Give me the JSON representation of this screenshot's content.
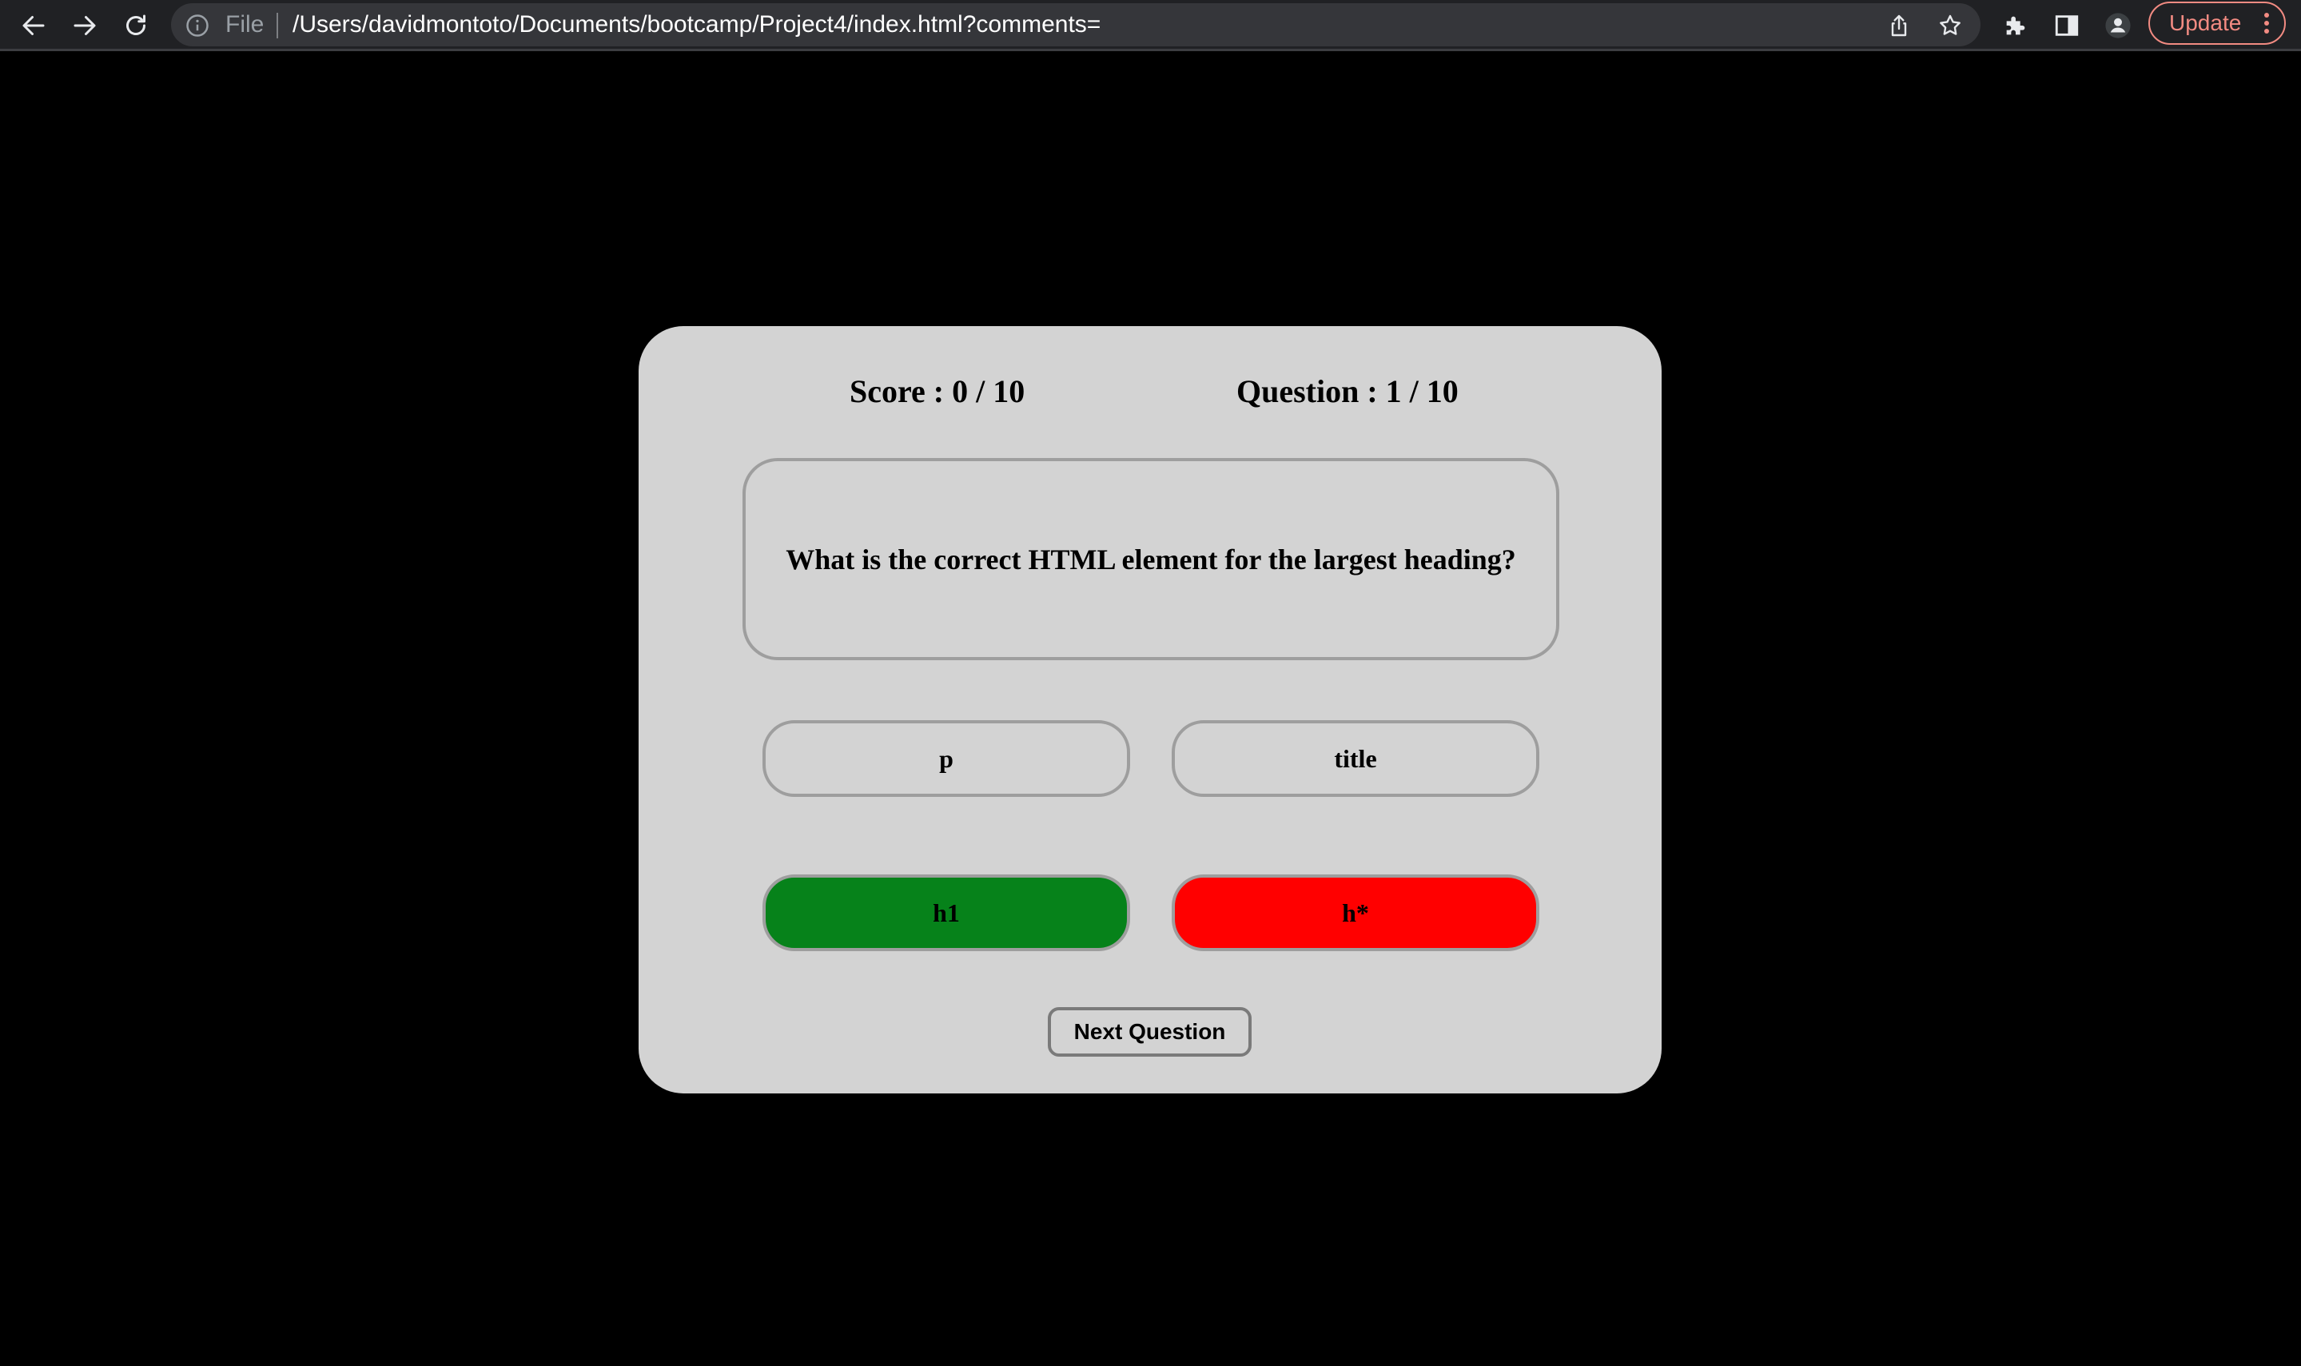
{
  "browser": {
    "scheme_label": "File",
    "url": "/Users/davidmontoto/Documents/bootcamp/Project4/index.html?comments=",
    "update_label": "Update",
    "icons": [
      "back-arrow-icon",
      "forward-arrow-icon",
      "reload-icon",
      "info-icon",
      "share-icon",
      "star-icon",
      "puzzle-icon",
      "side-panel-icon",
      "profile-icon",
      "kebab-menu-icon"
    ]
  },
  "quiz": {
    "score": "Score : 0 / 10",
    "question_counter": "Question : 1 / 10",
    "question": "What is the correct HTML element for the largest heading?",
    "answers": [
      {
        "label": "p",
        "state": "default"
      },
      {
        "label": "title",
        "state": "default"
      },
      {
        "label": "h1",
        "state": "correct"
      },
      {
        "label": "h*",
        "state": "incorrect"
      }
    ],
    "next_label": "Next Question"
  },
  "colors": {
    "page_background": "#000000",
    "card_background": "#d3d3d3",
    "correct": "#06821a",
    "incorrect": "#ff0000",
    "chrome_toolbar": "#202124",
    "update_accent": "#f28b82"
  }
}
